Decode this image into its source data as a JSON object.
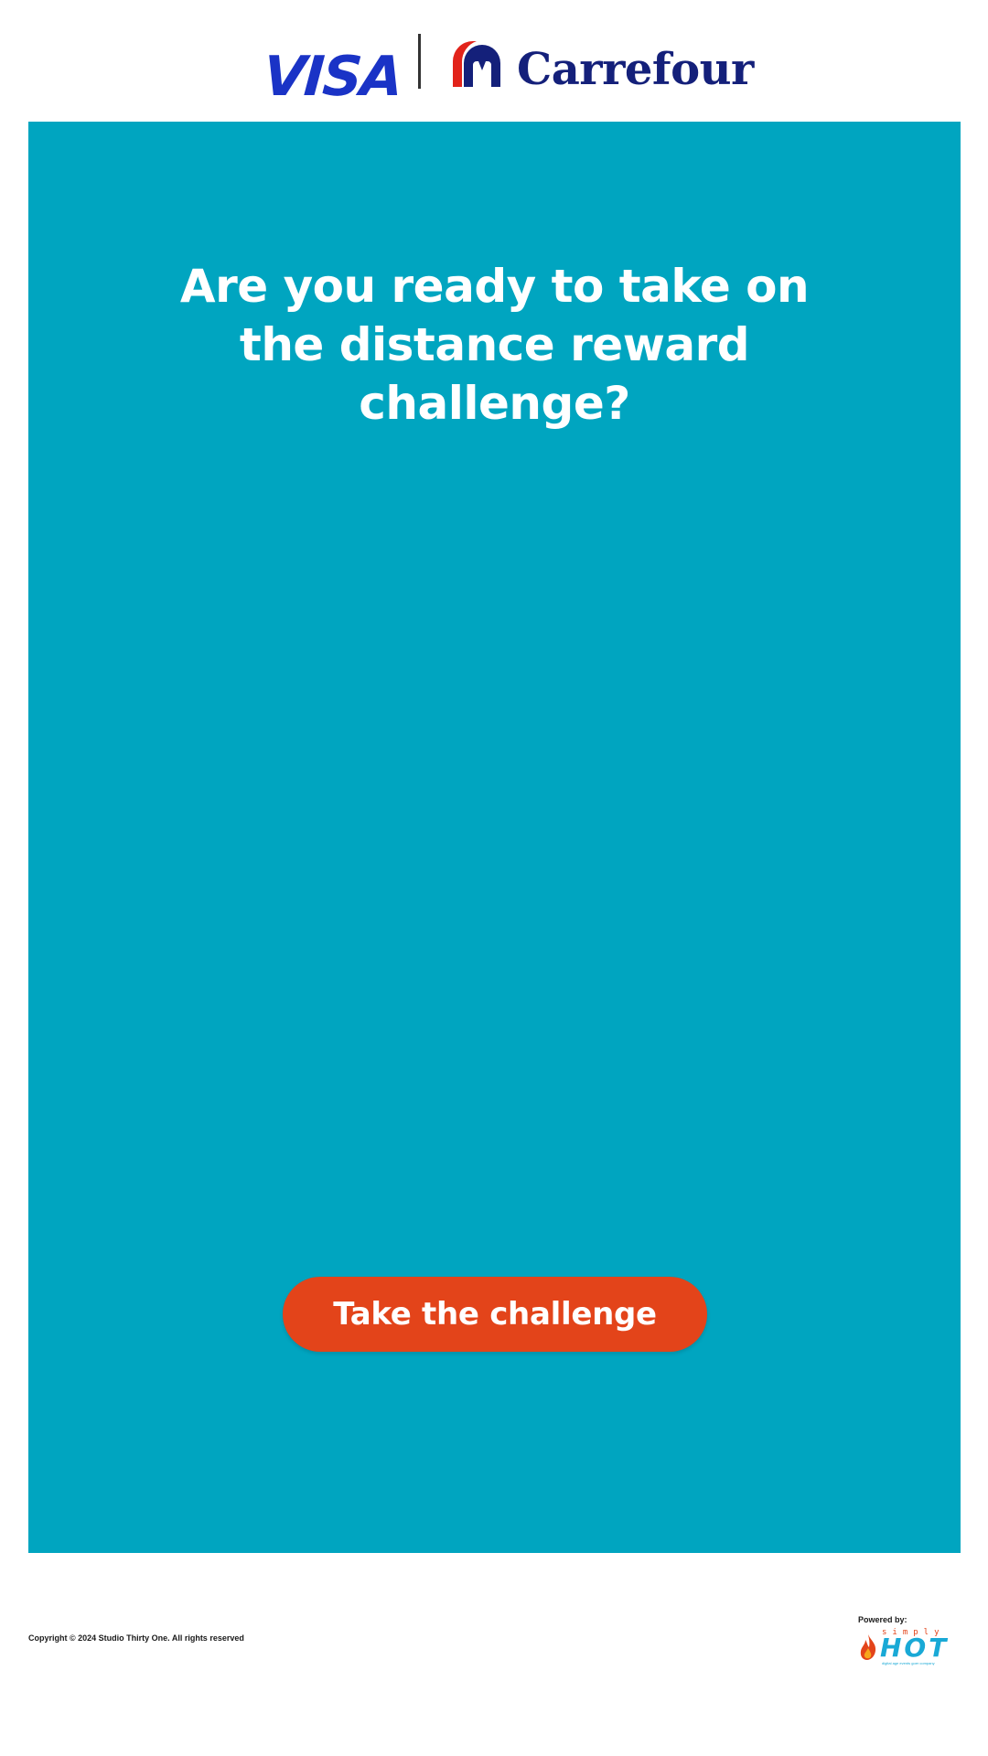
{
  "header": {
    "visa_logo_text": "VISA",
    "carrefour_name": "Carrefour"
  },
  "hero": {
    "title": "Are you ready to take on the distance reward challenge?",
    "cta_label": "Take the challenge"
  },
  "footer": {
    "copyright": "Copyright © 2024 Studio Thirty One. All rights reserved",
    "powered_by": "Powered by:",
    "brand_small": "simply",
    "brand_main": "HOT",
    "brand_tagline": "digital age events goer company"
  },
  "colors": {
    "hero_background": "#00a5c0",
    "cta_background": "#e3441a",
    "visa_blue": "#1a33c6",
    "carrefour_navy": "#14207a",
    "carrefour_red": "#e2231a",
    "brand_blue": "#19a9d6"
  },
  "icons": {
    "carrefour_mark": "carrefour-logo-icon",
    "flame": "flame-icon"
  }
}
